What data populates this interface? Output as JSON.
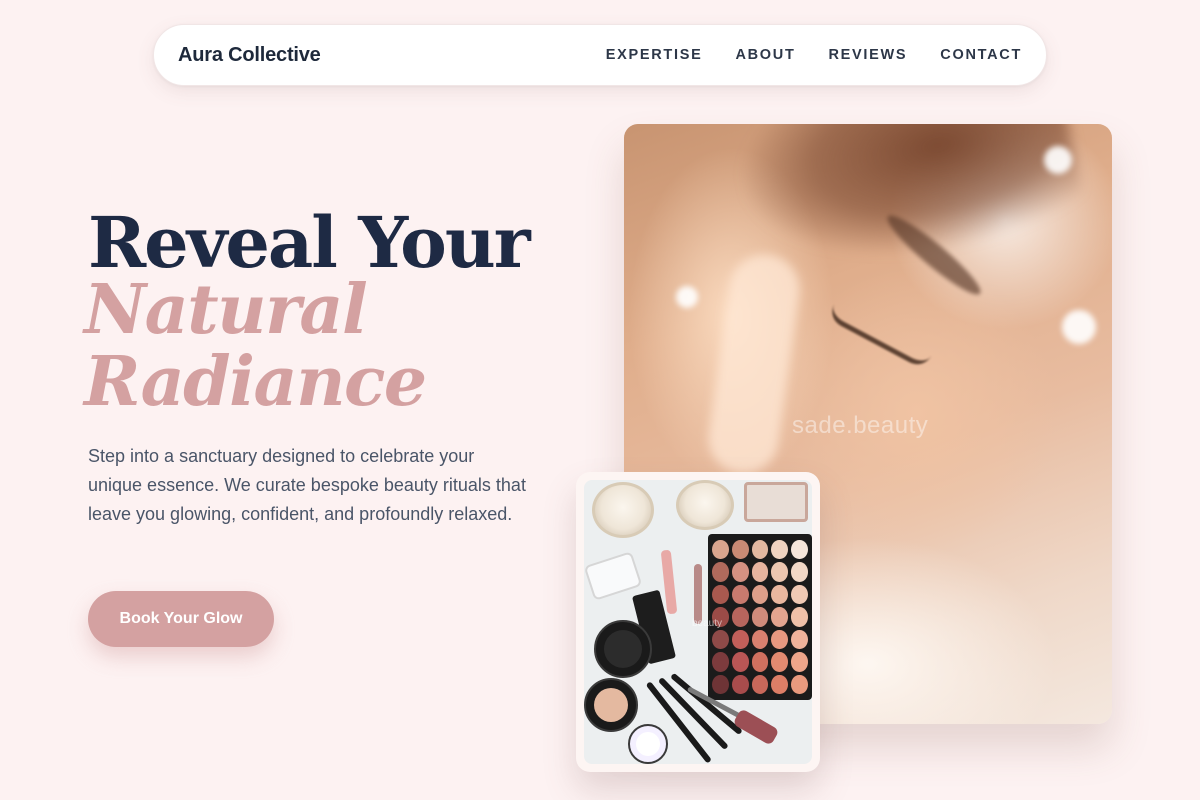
{
  "nav": {
    "brand": "Aura Collective",
    "links": [
      "EXPERTISE",
      "ABOUT",
      "REVIEWS",
      "CONTACT"
    ]
  },
  "hero": {
    "line1": "Reveal Your",
    "accent": "Natural Radiance",
    "copy": "Step into a sanctuary designed to celebrate your unique essence. We curate bespoke beauty rituals that leave you glowing, confident, and profoundly relaxed.",
    "cta": "Book Your Glow"
  },
  "images": {
    "main_watermark": "sade.beauty",
    "secondary_watermark": "beauty"
  },
  "colors": {
    "background": "#fdf2f2",
    "accent": "#d4a1a1",
    "heading": "#1e2a44",
    "body_text": "#4a5568"
  }
}
